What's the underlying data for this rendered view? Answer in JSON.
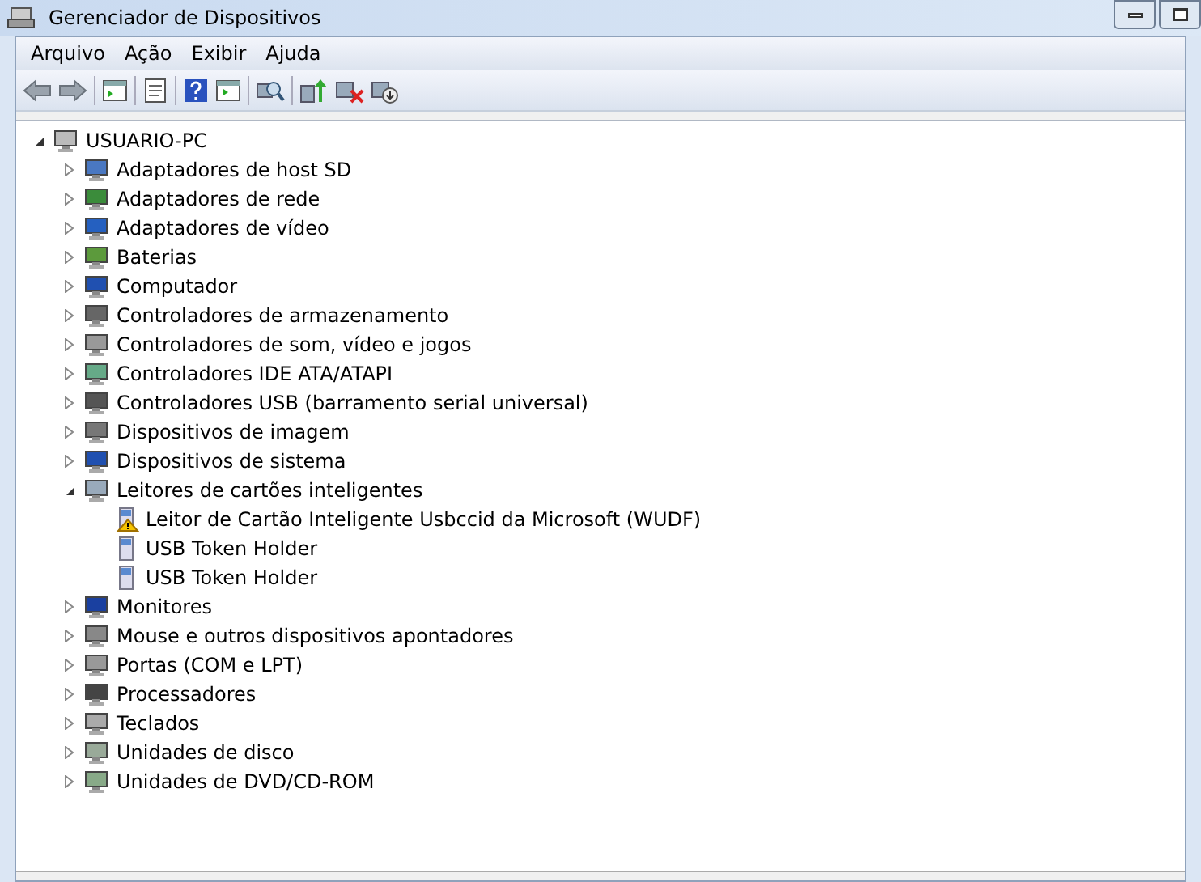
{
  "window": {
    "title": "Gerenciador de Dispositivos"
  },
  "menu": [
    "Arquivo",
    "Ação",
    "Exibir",
    "Ajuda"
  ],
  "tree": {
    "label": "USUARIO-PC",
    "expanded": true,
    "children": [
      {
        "label": "Adaptadores de host SD",
        "expanded": false
      },
      {
        "label": "Adaptadores de rede",
        "expanded": false
      },
      {
        "label": "Adaptadores de vídeo",
        "expanded": false
      },
      {
        "label": "Baterias",
        "expanded": false
      },
      {
        "label": "Computador",
        "expanded": false
      },
      {
        "label": "Controladores de armazenamento",
        "expanded": false
      },
      {
        "label": "Controladores de som, vídeo e jogos",
        "expanded": false
      },
      {
        "label": "Controladores IDE ATA/ATAPI",
        "expanded": false
      },
      {
        "label": "Controladores USB (barramento serial universal)",
        "expanded": false
      },
      {
        "label": "Dispositivos de imagem",
        "expanded": false
      },
      {
        "label": "Dispositivos de sistema",
        "expanded": false
      },
      {
        "label": "Leitores de cartões inteligentes",
        "expanded": true,
        "children": [
          {
            "label": "Leitor de Cartão Inteligente Usbccid da Microsoft (WUDF)",
            "warning": true
          },
          {
            "label": "USB Token Holder",
            "warning": false
          },
          {
            "label": "USB Token Holder",
            "warning": false
          }
        ]
      },
      {
        "label": "Monitores",
        "expanded": false
      },
      {
        "label": "Mouse e outros dispositivos apontadores",
        "expanded": false
      },
      {
        "label": "Portas (COM e LPT)",
        "expanded": false
      },
      {
        "label": "Processadores",
        "expanded": false
      },
      {
        "label": "Teclados",
        "expanded": false
      },
      {
        "label": "Unidades de disco",
        "expanded": false
      },
      {
        "label": "Unidades de DVD/CD-ROM",
        "expanded": false
      }
    ]
  }
}
